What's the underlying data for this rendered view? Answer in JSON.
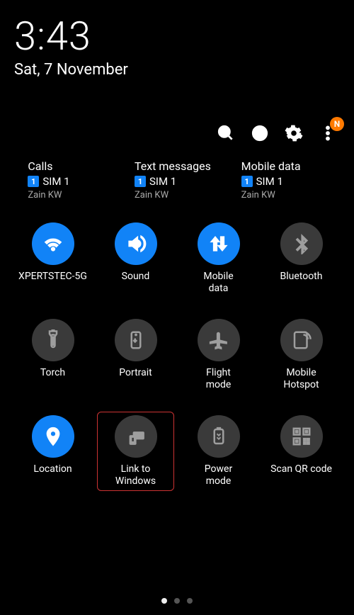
{
  "status": {
    "time": "3:43",
    "date": "Sat, 7 November"
  },
  "actions": {
    "badge": "N"
  },
  "sim_groups": [
    {
      "title": "Calls",
      "sim_num": "1",
      "sim_label": "SIM 1",
      "carrier": "Zain KW"
    },
    {
      "title": "Text messages",
      "sim_num": "1",
      "sim_label": "SIM 1",
      "carrier": "Zain KW"
    },
    {
      "title": "Mobile data",
      "sim_num": "1",
      "sim_label": "SIM 1",
      "carrier": "Zain KW"
    }
  ],
  "tiles": [
    {
      "key": "wifi",
      "label": "XPERTSTEC-5G",
      "icon": "wifi",
      "active": true,
      "highlight": false
    },
    {
      "key": "sound",
      "label": "Sound",
      "icon": "sound",
      "active": true,
      "highlight": false
    },
    {
      "key": "mobiledata",
      "label": "Mobile\ndata",
      "icon": "updown",
      "active": true,
      "highlight": false
    },
    {
      "key": "bluetooth",
      "label": "Bluetooth",
      "icon": "bluetooth",
      "active": false,
      "highlight": false
    },
    {
      "key": "torch",
      "label": "Torch",
      "icon": "torch",
      "active": false,
      "highlight": false
    },
    {
      "key": "portrait",
      "label": "Portrait",
      "icon": "portrait",
      "active": false,
      "highlight": false
    },
    {
      "key": "flight",
      "label": "Flight\nmode",
      "icon": "flight",
      "active": false,
      "highlight": false
    },
    {
      "key": "hotspot",
      "label": "Mobile\nHotspot",
      "icon": "hotspot",
      "active": false,
      "highlight": false
    },
    {
      "key": "location",
      "label": "Location",
      "icon": "location",
      "active": true,
      "highlight": false
    },
    {
      "key": "linkwin",
      "label": "Link to\nWindows",
      "icon": "linkwin",
      "active": false,
      "highlight": true
    },
    {
      "key": "power",
      "label": "Power\nmode",
      "icon": "power",
      "active": false,
      "highlight": false
    },
    {
      "key": "qr",
      "label": "Scan QR code",
      "icon": "qr",
      "active": false,
      "highlight": false
    }
  ],
  "page_indicator": {
    "count": 3,
    "active": 0
  }
}
